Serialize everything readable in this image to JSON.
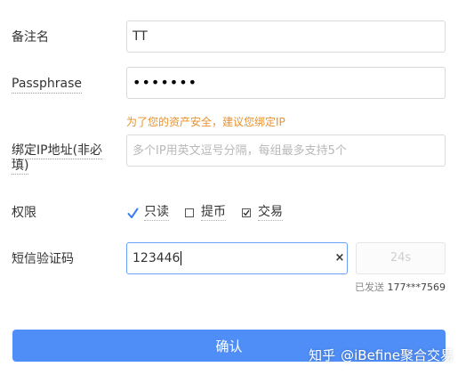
{
  "form": {
    "remark": {
      "label": "备注名",
      "value": "TT"
    },
    "passphrase": {
      "label": "Passphrase",
      "value": "•••••••"
    },
    "security_tip": "为了您的资产安全，建议您绑定IP",
    "bind_ip": {
      "label": "绑定IP地址(非必填)",
      "value": "",
      "placeholder": "多个IP用英文逗号分隔，每组最多支持5个"
    },
    "permissions": {
      "label": "权限",
      "options": [
        {
          "label": "只读",
          "checked": true,
          "style": "checkmark"
        },
        {
          "label": "提币",
          "checked": false,
          "style": "checkbox"
        },
        {
          "label": "交易",
          "checked": true,
          "style": "checkbox"
        }
      ]
    },
    "sms_code": {
      "label": "短信验证码",
      "value": "123446",
      "clear_icon": "×",
      "countdown": "24s",
      "sent_prefix": "已发送",
      "sent_phone": "177***7569"
    },
    "confirm_label": "确认"
  },
  "watermark": {
    "brand": "知乎",
    "author": "@iBefine聚合交易"
  },
  "colors": {
    "primary": "#4f8ef7",
    "warning": "#e8912e",
    "focus_border": "#6aa0f8"
  }
}
